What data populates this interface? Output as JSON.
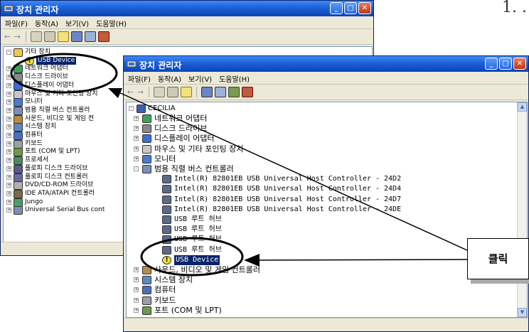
{
  "step_marker": "1. .",
  "back_window": {
    "title": "장치 관리자",
    "menu": [
      "파일(F)",
      "동작(A)",
      "보기(V)",
      "도움말(H)"
    ],
    "tree_items": [
      {
        "label": "기타 장치",
        "icon": "question-folder-icon"
      },
      {
        "label": "USB Device",
        "icon": "warning-device-icon",
        "selected": true
      },
      {
        "label": "네트워크 어댑터",
        "icon": "network-icon"
      },
      {
        "label": "디스크 드라이브",
        "icon": "disk-icon"
      },
      {
        "label": "디스플레이 어댑터",
        "icon": "display-icon"
      },
      {
        "label": "마우스 및 기타 포인팅 장치",
        "icon": "mouse-icon"
      },
      {
        "label": "모니터",
        "icon": "monitor-icon"
      },
      {
        "label": "범용 직렬 버스 컨트롤러",
        "icon": "usb-icon"
      },
      {
        "label": "사운드, 비디오 및 게임 컨",
        "icon": "sound-icon"
      },
      {
        "label": "시스템 장치",
        "icon": "system-icon"
      },
      {
        "label": "컴퓨터",
        "icon": "computer-icon"
      },
      {
        "label": "키보드",
        "icon": "keyboard-icon"
      },
      {
        "label": "포트 (COM 및 LPT)",
        "icon": "port-icon"
      },
      {
        "label": "프로세서",
        "icon": "processor-icon"
      },
      {
        "label": "플로피 디스크 드라이브",
        "icon": "floppy-icon"
      },
      {
        "label": "플로피 디스크 컨트롤러",
        "icon": "floppy-controller-icon"
      },
      {
        "label": "DVD/CD-ROM 드라이브",
        "icon": "cdrom-icon"
      },
      {
        "label": "IDE ATA/ATAPI 컨트롤러",
        "icon": "ide-icon"
      },
      {
        "label": "Jungo",
        "icon": "jungo-icon"
      },
      {
        "label": "Universal Serial Bus cont",
        "icon": "usb-icon"
      }
    ]
  },
  "front_window": {
    "title": "장치 관리자",
    "menu": [
      "파일(F)",
      "동작(A)",
      "보기(V)",
      "도움말(H)"
    ],
    "tree_root": "CECILIA",
    "tree_items": [
      {
        "label": "네트워크 어댑터",
        "level": 1,
        "icon": "network-icon"
      },
      {
        "label": "디스크 드라이브",
        "level": 1,
        "icon": "disk-icon"
      },
      {
        "label": "디스플레이 어댑터",
        "level": 1,
        "icon": "display-icon"
      },
      {
        "label": "마우스 및 기타 포인팅 장치",
        "level": 1,
        "icon": "mouse-icon"
      },
      {
        "label": "모니터",
        "level": 1,
        "icon": "monitor-icon"
      },
      {
        "label": "범용 직렬 버스 컨트롤러",
        "level": 1,
        "icon": "usb-icon",
        "expanded": true
      },
      {
        "label": "Intel(R) 82801EB USB Universal Host Controller - 24D2",
        "level": 2,
        "icon": "usb-plug-icon"
      },
      {
        "label": "Intel(R) 82801EB USB Universal Host Controller - 24D4",
        "level": 2,
        "icon": "usb-plug-icon"
      },
      {
        "label": "Intel(R) 82801EB USB Universal Host Controller - 24D7",
        "level": 2,
        "icon": "usb-plug-icon"
      },
      {
        "label": "Intel(R) 82801EB USB Universal Host Controller - 24DE",
        "level": 2,
        "icon": "usb-plug-icon"
      },
      {
        "label": "USB 루트 허브",
        "level": 2,
        "icon": "usb-plug-icon"
      },
      {
        "label": "USB 루트 허브",
        "level": 2,
        "icon": "usb-plug-icon"
      },
      {
        "label": "USB 루트 허브",
        "level": 2,
        "icon": "usb-plug-icon"
      },
      {
        "label": "USB 루트 허브",
        "level": 2,
        "icon": "usb-plug-icon"
      },
      {
        "label": "USB Device",
        "level": 2,
        "icon": "warning-device-icon",
        "selected": true
      },
      {
        "label": "사운드, 비디오 및 게임 컨트롤러",
        "level": 1,
        "icon": "sound-icon"
      },
      {
        "label": "시스템 장치",
        "level": 1,
        "icon": "system-icon"
      },
      {
        "label": "컴퓨터",
        "level": 1,
        "icon": "computer-icon"
      },
      {
        "label": "키보드",
        "level": 1,
        "icon": "keyboard-icon"
      },
      {
        "label": "포트 (COM 및 LPT)",
        "level": 1,
        "icon": "port-icon"
      }
    ]
  },
  "callout": {
    "label": "클릭"
  },
  "colors": {
    "titlebar": "#1d5fd6",
    "close": "#c2380f",
    "window": "#ece9d8",
    "selection": "#0a246a"
  }
}
